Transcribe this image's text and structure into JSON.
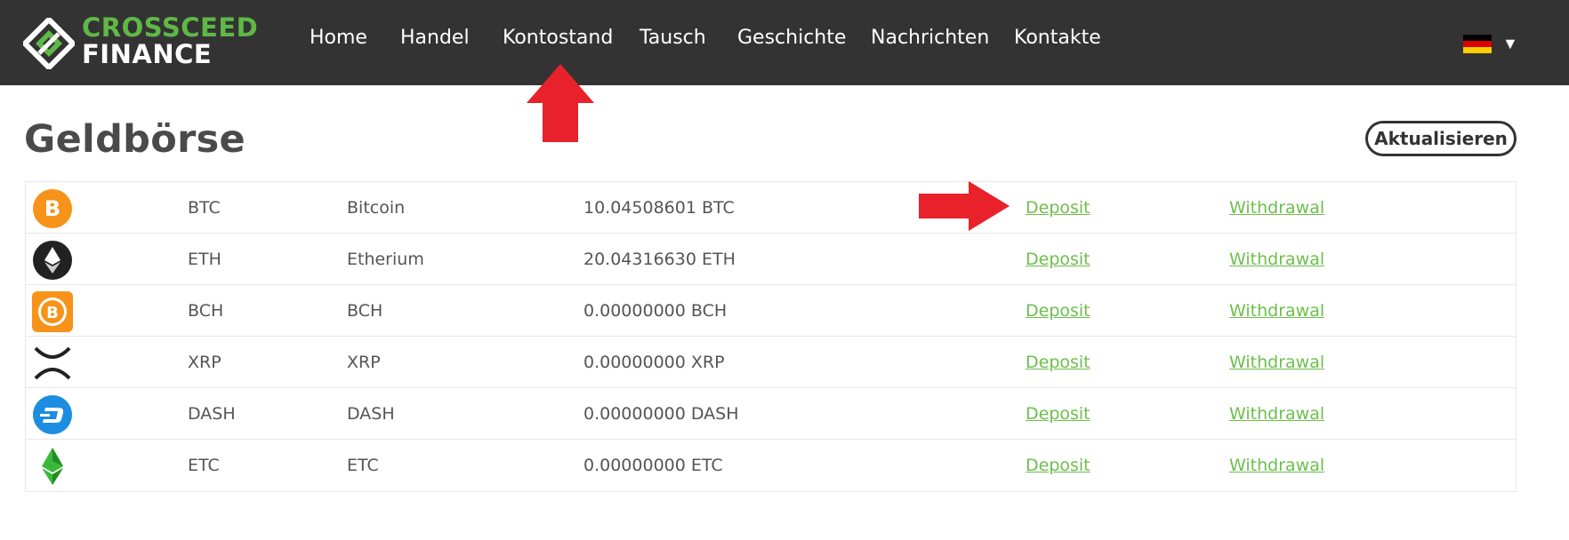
{
  "brand": {
    "line1": "CROSSCEED",
    "line2": "FINANCE",
    "accent": "#5fb846"
  },
  "nav": {
    "items": [
      {
        "label": "Home"
      },
      {
        "label": "Handel"
      },
      {
        "label": "Kontostand"
      },
      {
        "label": "Tausch"
      },
      {
        "label": "Geschichte"
      },
      {
        "label": "Nachrichten"
      },
      {
        "label": "Kontakte"
      }
    ],
    "language": {
      "flag": "germany-flag-icon",
      "caret": "▼"
    }
  },
  "page": {
    "title": "Geldbörse",
    "refresh_label": "Aktualisieren"
  },
  "wallets": [
    {
      "icon": "bitcoin-icon",
      "symbol": "BTC",
      "name": "Bitcoin",
      "balance": "10.04508601 BTC",
      "deposit": "Deposit",
      "withdrawal": "Withdrawal"
    },
    {
      "icon": "ethereum-icon",
      "symbol": "ETH",
      "name": "Etherium",
      "balance": "20.04316630 ETH",
      "deposit": "Deposit",
      "withdrawal": "Withdrawal"
    },
    {
      "icon": "bitcoin-cash-icon",
      "symbol": "BCH",
      "name": "BCH",
      "balance": "0.00000000 BCH",
      "deposit": "Deposit",
      "withdrawal": "Withdrawal"
    },
    {
      "icon": "xrp-icon",
      "symbol": "XRP",
      "name": "XRP",
      "balance": "0.00000000 XRP",
      "deposit": "Deposit",
      "withdrawal": "Withdrawal"
    },
    {
      "icon": "dash-icon",
      "symbol": "DASH",
      "name": "DASH",
      "balance": "0.00000000 DASH",
      "deposit": "Deposit",
      "withdrawal": "Withdrawal"
    },
    {
      "icon": "ethereum-classic-icon",
      "symbol": "ETC",
      "name": "ETC",
      "balance": "0.00000000 ETC",
      "deposit": "Deposit",
      "withdrawal": "Withdrawal"
    }
  ],
  "colors": {
    "navbar": "#333333",
    "link": "#6cbf4b",
    "annotation_arrow": "#e8212a"
  }
}
